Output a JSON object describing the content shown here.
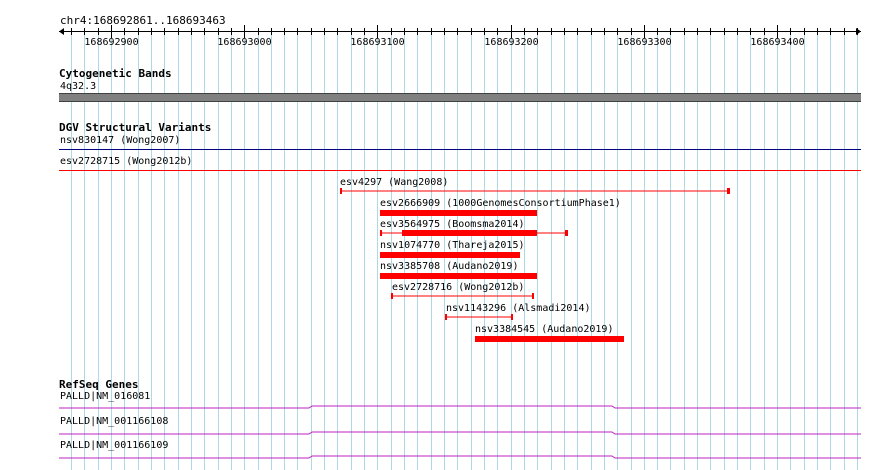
{
  "locus": "chr4:168692861..168693463",
  "ruler": {
    "ticks": [
      {
        "pos": 168692900,
        "label": "168692900"
      },
      {
        "pos": 168693000,
        "label": "168693000"
      },
      {
        "pos": 168693100,
        "label": "168693100"
      },
      {
        "pos": 168693200,
        "label": "168693200"
      },
      {
        "pos": 168693300,
        "label": "168693300"
      },
      {
        "pos": 168693400,
        "label": "168693400"
      }
    ]
  },
  "colors": {
    "grid": "#add8e6",
    "band": "#808080",
    "variant": "#ff0000",
    "variant_loss_line": "#000080",
    "gene": "#c020c0"
  },
  "tracks": {
    "cytoband": {
      "title": "Cytogenetic Bands",
      "band_label": "4q32.3"
    },
    "dgv": {
      "title": "DGV Structural Variants",
      "variants": [
        {
          "label": "nsv830147 (Wong2007)",
          "style": "full-line",
          "color": "#000080"
        },
        {
          "label": "esv2728715 (Wong2012b)",
          "style": "full-line",
          "color": "#ff0000"
        },
        {
          "label": "esv4297 (Wang2008)",
          "style": "line"
        },
        {
          "label": "esv2666909 (1000GenomesConsortiumPhase1)",
          "style": "bar"
        },
        {
          "label": "esv3564975 (Boomsma2014)",
          "style": "bar-whisker"
        },
        {
          "label": "nsv1074770 (Thareja2015)",
          "style": "bar"
        },
        {
          "label": "nsv3385708 (Audano2019)",
          "style": "bar"
        },
        {
          "label": "esv2728716 (Wong2012b)",
          "style": "line"
        },
        {
          "label": "nsv1143296 (Alsmadi2014)",
          "style": "line"
        },
        {
          "label": "nsv3384545 (Audano2019)",
          "style": "bar"
        }
      ]
    },
    "refseq": {
      "title": "RefSeq Genes",
      "genes": [
        {
          "label": "PALLD|NM_016081"
        },
        {
          "label": "PALLD|NM_001166108"
        },
        {
          "label": "PALLD|NM_001166109"
        }
      ]
    }
  }
}
